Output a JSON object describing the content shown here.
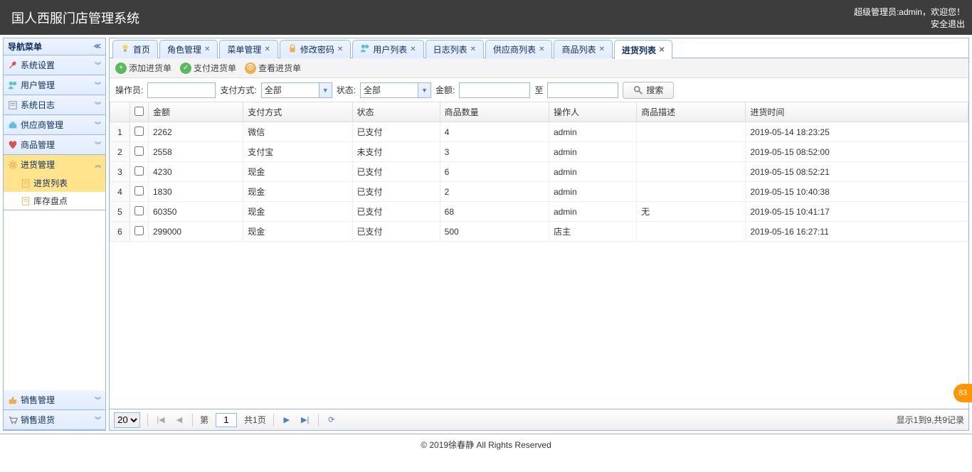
{
  "header": {
    "title": "国人西服门店管理系统",
    "welcome_prefix": "超级管理员:",
    "welcome_user": "admin",
    "welcome_suffix": "，欢迎您！",
    "logout": "安全退出"
  },
  "sidebar": {
    "title": "导航菜单",
    "panels": [
      {
        "label": "系统设置",
        "icon": "wrench"
      },
      {
        "label": "用户管理",
        "icon": "users"
      },
      {
        "label": "系统日志",
        "icon": "log"
      },
      {
        "label": "供应商管理",
        "icon": "supplier"
      },
      {
        "label": "商品管理",
        "icon": "heart"
      },
      {
        "label": "进货管理",
        "icon": "gear",
        "active": true,
        "items": [
          {
            "label": "进货列表",
            "selected": true
          },
          {
            "label": "库存盘点",
            "selected": false
          }
        ]
      },
      {
        "label": "销售管理",
        "icon": "thumb",
        "bottom": true
      },
      {
        "label": "销售退货",
        "icon": "cart",
        "bottom": true
      }
    ]
  },
  "tabs": [
    {
      "label": "首页",
      "icon": "bulb",
      "closable": false
    },
    {
      "label": "角色管理",
      "closable": true
    },
    {
      "label": "菜单管理",
      "closable": true
    },
    {
      "label": "修改密码",
      "icon": "lock",
      "closable": true
    },
    {
      "label": "用户列表",
      "icon": "users",
      "closable": true
    },
    {
      "label": "日志列表",
      "closable": true
    },
    {
      "label": "供应商列表",
      "closable": true
    },
    {
      "label": "商品列表",
      "closable": true
    },
    {
      "label": "进货列表",
      "closable": true,
      "active": true
    }
  ],
  "toolbar": {
    "add": "添加进货单",
    "pay": "支付进货单",
    "view": "查看进货单"
  },
  "search": {
    "operator_label": "操作员:",
    "paymethod_label": "支付方式:",
    "paymethod_value": "全部",
    "status_label": "状态:",
    "status_value": "全部",
    "amount_label": "金额:",
    "to_label": "至",
    "button": "搜索"
  },
  "grid": {
    "headers": [
      "金额",
      "支付方式",
      "状态",
      "商品数量",
      "操作人",
      "商品描述",
      "进货时间"
    ],
    "rows": [
      {
        "n": "1",
        "amount": "2262",
        "method": "微信",
        "status": "已支付",
        "qty": "4",
        "op": "admin",
        "desc": "",
        "time": "2019-05-14 18:23:25"
      },
      {
        "n": "2",
        "amount": "2558",
        "method": "支付宝",
        "status": "未支付",
        "qty": "3",
        "op": "admin",
        "desc": "",
        "time": "2019-05-15 08:52:00"
      },
      {
        "n": "3",
        "amount": "4230",
        "method": "现金",
        "status": "已支付",
        "qty": "6",
        "op": "admin",
        "desc": "",
        "time": "2019-05-15 08:52:21"
      },
      {
        "n": "4",
        "amount": "1830",
        "method": "现金",
        "status": "已支付",
        "qty": "2",
        "op": "admin",
        "desc": "",
        "time": "2019-05-15 10:40:38"
      },
      {
        "n": "5",
        "amount": "60350",
        "method": "现金",
        "status": "已支付",
        "qty": "68",
        "op": "admin",
        "desc": "无",
        "time": "2019-05-15 10:41:17"
      },
      {
        "n": "6",
        "amount": "299000",
        "method": "现金",
        "status": "已支付",
        "qty": "500",
        "op": "店主",
        "desc": "",
        "time": "2019-05-16 16:27:11"
      }
    ]
  },
  "pager": {
    "size": "20",
    "page_prefix": "第",
    "page_value": "1",
    "total_pages": "共1页",
    "info": "显示1到9,共9记录"
  },
  "footer": "© 2019徐春静 All Rights Reserved",
  "side_badge": "83"
}
